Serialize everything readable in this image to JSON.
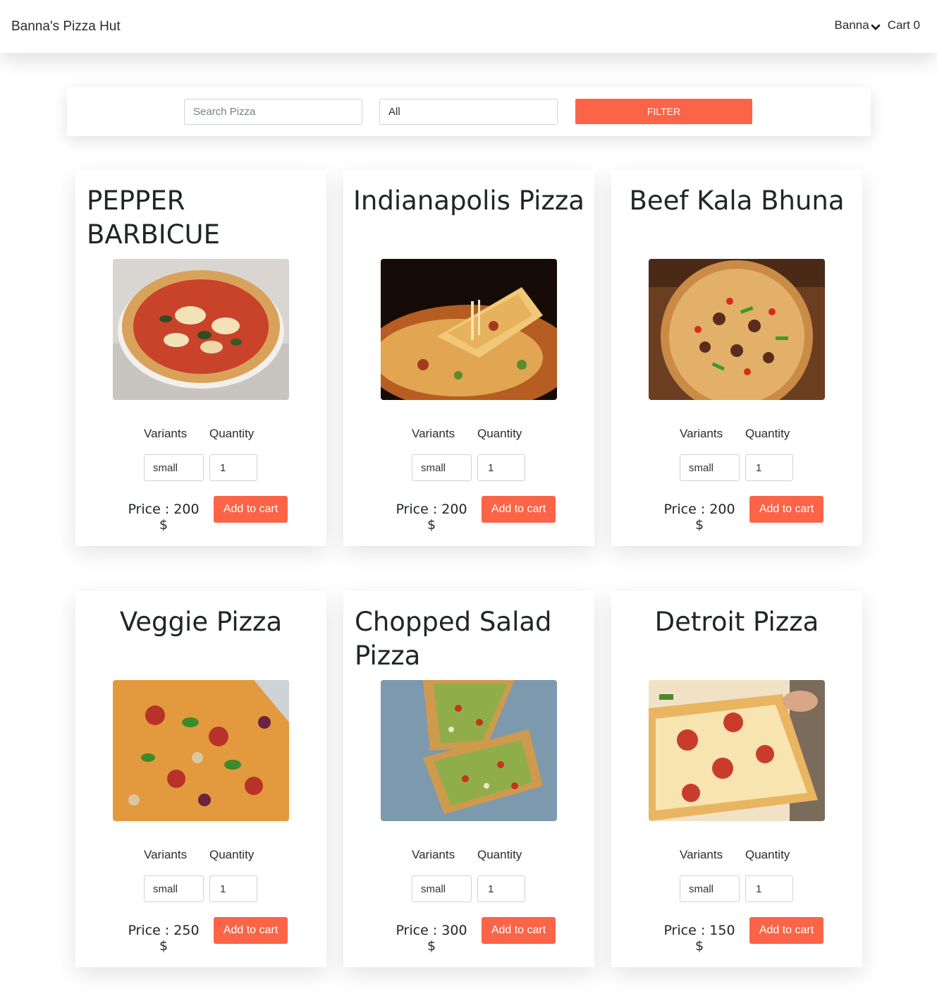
{
  "navbar": {
    "brand": "Banna's Pizza Hut",
    "user": "Banna",
    "cart": "Cart 0"
  },
  "filter": {
    "search_placeholder": "Search Pizza",
    "category": "All",
    "button": "FILTER"
  },
  "pizzas": [
    {
      "name": "PEPPER BARBICUE",
      "variants_label": "Variants",
      "quantity_label": "Quantity",
      "variant": "small",
      "quantity": "1",
      "price": "Price : 200 $",
      "add_label": "Add to cart"
    },
    {
      "name": "Indianapolis Pizza",
      "variants_label": "Variants",
      "quantity_label": "Quantity",
      "variant": "small",
      "quantity": "1",
      "price": "Price : 200 $",
      "add_label": "Add to cart"
    },
    {
      "name": "Beef Kala Bhuna",
      "variants_label": "Variants",
      "quantity_label": "Quantity",
      "variant": "small",
      "quantity": "1",
      "price": "Price : 200 $",
      "add_label": "Add to cart"
    },
    {
      "name": "Veggie Pizza",
      "variants_label": "Variants",
      "quantity_label": "Quantity",
      "variant": "small",
      "quantity": "1",
      "price": "Price : 250 $",
      "add_label": "Add to cart"
    },
    {
      "name": "Chopped Salad Pizza",
      "variants_label": "Variants",
      "quantity_label": "Quantity",
      "variant": "small",
      "quantity": "1",
      "price": "Price : 300 $",
      "add_label": "Add to cart"
    },
    {
      "name": "Detroit Pizza",
      "variants_label": "Variants",
      "quantity_label": "Quantity",
      "variant": "small",
      "quantity": "1",
      "price": "Price : 150 $",
      "add_label": "Add to cart"
    }
  ],
  "colors": {
    "accent": "#fb6447",
    "text": "#212529"
  }
}
